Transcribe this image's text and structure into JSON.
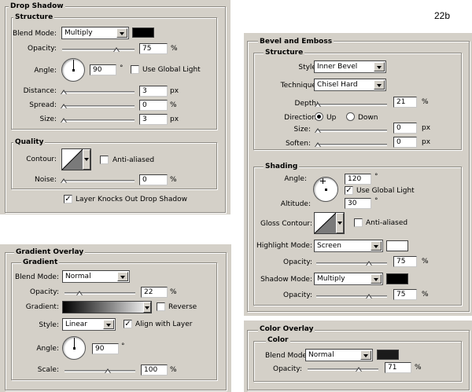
{
  "figure_label": "22b",
  "drop_shadow": {
    "title": "Drop Shadow",
    "structure_title": "Structure",
    "blend_mode_label": "Blend Mode:",
    "blend_mode": "Multiply",
    "color": "#000000",
    "opacity_label": "Opacity:",
    "opacity": "75",
    "opacity_unit": "%",
    "angle_label": "Angle:",
    "angle": "90",
    "angle_unit": "°",
    "use_global_light": "Use Global Light",
    "distance_label": "Distance:",
    "distance": "3",
    "distance_unit": "px",
    "spread_label": "Spread:",
    "spread": "0",
    "spread_unit": "%",
    "size_label": "Size:",
    "size": "3",
    "size_unit": "px",
    "quality_title": "Quality",
    "contour_label": "Contour:",
    "anti_aliased": "Anti-aliased",
    "noise_label": "Noise:",
    "noise": "0",
    "noise_unit": "%",
    "knockout_check": "✓",
    "knockout_label": "Layer Knocks Out Drop Shadow"
  },
  "bevel": {
    "title": "Bevel and Emboss",
    "structure_title": "Structure",
    "style_label": "Style:",
    "style": "Inner Bevel",
    "technique_label": "Technique:",
    "technique": "Chisel Hard",
    "depth_label": "Depth:",
    "depth": "21",
    "depth_unit": "%",
    "direction_label": "Direction:",
    "dir_up": "Up",
    "dir_down": "Down",
    "size_label": "Size:",
    "size": "0",
    "size_unit": "px",
    "soften_label": "Soften:",
    "soften": "0",
    "soften_unit": "px",
    "shading_title": "Shading",
    "angle_label": "Angle:",
    "angle": "120",
    "angle_unit": "°",
    "global_light_check": "✓",
    "use_global_light": "Use Global Light",
    "altitude_label": "Altitude:",
    "altitude": "30",
    "altitude_unit": "°",
    "gloss_label": "Gloss Contour:",
    "anti_aliased": "Anti-aliased",
    "highlight_label": "Highlight Mode:",
    "highlight_mode": "Screen",
    "highlight_color": "#ffffff",
    "h_opacity_label": "Opacity:",
    "h_opacity": "75",
    "h_opacity_unit": "%",
    "shadow_label": "Shadow Mode:",
    "shadow_mode": "Multiply",
    "shadow_color": "#000000",
    "s_opacity_label": "Opacity:",
    "s_opacity": "75",
    "s_opacity_unit": "%"
  },
  "gradient": {
    "title": "Gradient Overlay",
    "group_title": "Gradient",
    "blend_mode_label": "Blend Mode:",
    "blend_mode": "Normal",
    "opacity_label": "Opacity:",
    "opacity": "22",
    "opacity_unit": "%",
    "gradient_label": "Gradient:",
    "reverse": "Reverse",
    "style_label": "Style:",
    "style": "Linear",
    "align_check": "✓",
    "align": "Align with Layer",
    "angle_label": "Angle:",
    "angle": "90",
    "angle_unit": "°",
    "scale_label": "Scale:",
    "scale": "100",
    "scale_unit": "%"
  },
  "color_overlay": {
    "title": "Color Overlay",
    "group_title": "Color",
    "blend_mode_label": "Blend Mode:",
    "blend_mode": "Normal",
    "color": "#1a1a1a",
    "opacity_label": "Opacity:",
    "opacity": "71",
    "opacity_unit": "%"
  }
}
